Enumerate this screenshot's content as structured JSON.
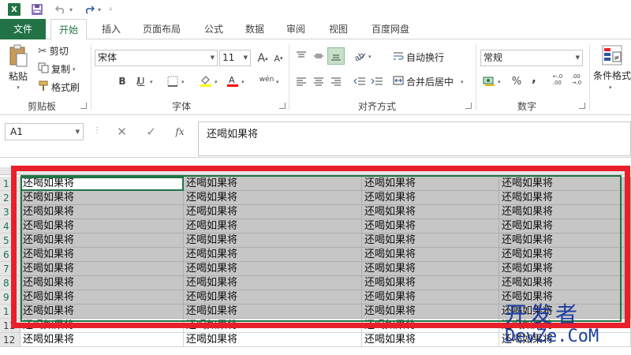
{
  "quick_access": {
    "app_icon": "excel-logo",
    "logo_letter": "X",
    "save_icon": "save-icon",
    "undo_icon": "undo-icon",
    "redo_icon": "redo-icon"
  },
  "tabs": [
    {
      "label": "文件"
    },
    {
      "label": "开始"
    },
    {
      "label": "插入"
    },
    {
      "label": "页面布局"
    },
    {
      "label": "公式"
    },
    {
      "label": "数据"
    },
    {
      "label": "审阅"
    },
    {
      "label": "视图"
    },
    {
      "label": "百度网盘"
    }
  ],
  "ribbon": {
    "clipboard": {
      "paste_label": "粘贴",
      "cut_label": "剪切",
      "copy_label": "复制",
      "format_painter_label": "格式刷",
      "group_label": "剪贴板"
    },
    "font": {
      "font_name": "宋体",
      "font_size": "11",
      "bold": "B",
      "italic": "I",
      "underline": "U",
      "phonetic": "wén",
      "group_label": "字体",
      "highlight_color": "#ffff00",
      "font_color": "#ff0000",
      "grow_letter": "A",
      "shrink_letter": "A"
    },
    "alignment": {
      "wrap_text_label": "自动换行",
      "merge_center_label": "合并后居中",
      "group_label": "对齐方式"
    },
    "number": {
      "format": "常规",
      "percent": "%",
      "comma": ",",
      "increase_decimal": "←.0\n.00",
      "decrease_decimal": ".00\n→.0",
      "group_label": "数字"
    },
    "styles": {
      "conditional_format_label": "条件格式"
    }
  },
  "formula_bar": {
    "name_box": "A1",
    "fx_label": "fx",
    "formula": "还喝如果将"
  },
  "sheet": {
    "row_numbers": [
      "1",
      "2",
      "3",
      "4",
      "5",
      "6",
      "7",
      "8",
      "9",
      "1",
      "11",
      "12"
    ],
    "rows": [
      [
        "还喝如果将",
        "还喝如果将",
        "还喝如果将",
        "还喝如果将"
      ],
      [
        "还喝如果将",
        "还喝如果将",
        "还喝如果将",
        "还喝如果将"
      ],
      [
        "还喝如果将",
        "还喝如果将",
        "还喝如果将",
        "还喝如果将"
      ],
      [
        "还喝如果将",
        "还喝如果将",
        "还喝如果将",
        "还喝如果将"
      ],
      [
        "还喝如果将",
        "还喝如果将",
        "还喝如果将",
        "还喝如果将"
      ],
      [
        "还喝如果将",
        "还喝如果将",
        "还喝如果将",
        "还喝如果将"
      ],
      [
        "还喝如果将",
        "还喝如果将",
        "还喝如果将",
        "还喝如果将"
      ],
      [
        "还喝如果将",
        "还喝如果将",
        "还喝如果将",
        "还喝如果将"
      ],
      [
        "还喝如果将",
        "还喝如果将",
        "还喝如果将",
        "还喝如果将"
      ],
      [
        "还喝如果将",
        "还喝如果将",
        "还喝如果将",
        "还喝如果将"
      ],
      [
        "还喝如果将",
        "还喝如果将",
        "还喝如果将",
        "还喝如果将"
      ],
      [
        "还喝如果将",
        "还喝如果将",
        "还喝如果将",
        "还喝如果将"
      ]
    ],
    "selected_rows": 10,
    "selection_fill": "#c6c6c6",
    "highlight_frame_color": "#e8202a"
  },
  "watermark": {
    "top": "开发者",
    "bottom": "DevZe.CoM"
  }
}
